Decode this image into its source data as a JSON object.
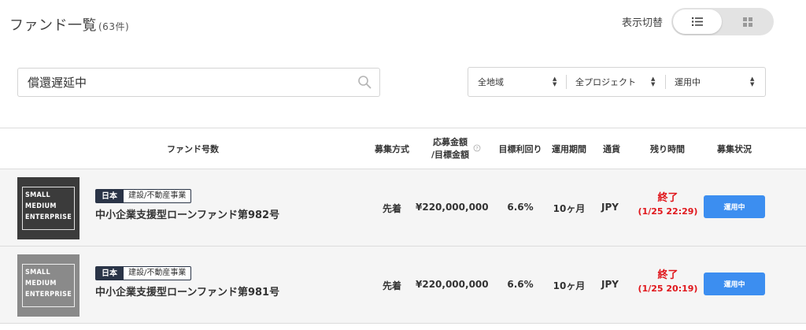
{
  "header": {
    "title": "ファンド一覧",
    "count": "(63件)",
    "view_toggle_label": "表示切替"
  },
  "search": {
    "value": "償還遅延中",
    "icon": "search-icon"
  },
  "filters": [
    {
      "label": "全地域"
    },
    {
      "label": "全プロジェクト"
    },
    {
      "label": "運用中"
    }
  ],
  "table": {
    "columns": {
      "fund_name": "ファンド号数",
      "method": "募集方式",
      "amount_line1": "応募金額",
      "amount_line2": "/目標金額",
      "yield": "目標利回り",
      "period": "運用期間",
      "currency": "通貨",
      "remaining": "残り時間",
      "status": "募集状況"
    },
    "rows": [
      {
        "thumb_text": [
          "SMALL",
          "MEDIUM",
          "ENTERPRISE"
        ],
        "country": "日本",
        "category": "建設/不動産事業",
        "name": "中小企業支援型ローンファンド第982号",
        "method": "先着",
        "amount": "¥220,000,000",
        "yield": "6.6%",
        "period": "10ヶ月",
        "currency": "JPY",
        "remaining_status": "終了",
        "remaining_time": "(1/25 22:29)",
        "status": "運用中"
      },
      {
        "thumb_text": [
          "SMALL",
          "MEDIUM",
          "ENTERPRISE"
        ],
        "country": "日本",
        "category": "建設/不動産事業",
        "name": "中小企業支援型ローンファンド第981号",
        "method": "先着",
        "amount": "¥220,000,000",
        "yield": "6.6%",
        "period": "10ヶ月",
        "currency": "JPY",
        "remaining_status": "終了",
        "remaining_time": "(1/25 20:19)",
        "status": "運用中"
      }
    ]
  },
  "colors": {
    "status_button": "#3c8ef0",
    "remaining_red": "#e0161b",
    "country_tag": "#2a3447"
  }
}
